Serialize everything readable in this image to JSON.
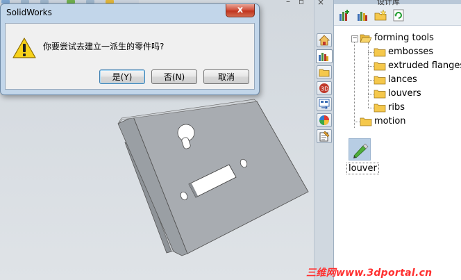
{
  "dialog": {
    "title": "SolidWorks",
    "close_label": "x",
    "message": "你要尝试去建立一派生的零件吗?",
    "buttons": {
      "yes": "是(Y)",
      "no": "否(N)",
      "cancel": "取消"
    }
  },
  "panel": {
    "title": "设计库",
    "tree": {
      "root": "forming tools",
      "children": [
        "embosses",
        "extruded flanges",
        "lances",
        "louvers",
        "ribs"
      ],
      "sibling": "motion"
    },
    "files": [
      {
        "name": "louver"
      }
    ]
  },
  "watermark": "三维网www.3dportal.cn",
  "colors": {
    "dialog_frame": "#c2d6ea",
    "folder": "#f5c84c",
    "part": "#a7abb0",
    "watermark": "#ff3030"
  }
}
